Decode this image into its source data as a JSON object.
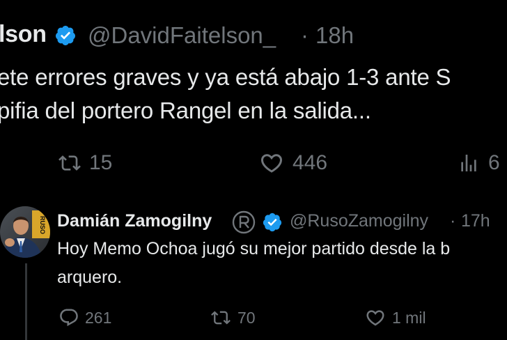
{
  "tweet_top": {
    "name_fragment": "lson",
    "handle": "@DavidFaitelson_",
    "separator": "·",
    "time": "18h",
    "text_line1": "ete errores graves y ya está abajo 1-3 ante S",
    "text_line2": "pifia del portero Rangel en la salida...",
    "retweets": "15",
    "likes": "446",
    "views_fragment": "6"
  },
  "tweet_reply": {
    "name": "Damián Zamogilny",
    "handle": "@RusoZamogilny",
    "separator": "·",
    "time": "17h",
    "text_line1": "Hoy Memo Ochoa jugó su mejor partido desde la b",
    "text_line2": "arquero.",
    "replies": "261",
    "retweets": "70",
    "likes": "1 mil",
    "avatar_logo_text": "RUSO"
  },
  "colors": {
    "background": "#000000",
    "text_primary": "#e7e9ea",
    "text_secondary": "#71767b",
    "verified_blue": "#1d9bf0",
    "thread_line": "#333639"
  },
  "icons": [
    "verified-badge-icon",
    "retweet-icon",
    "heart-icon",
    "views-icon",
    "reply-icon",
    "registered-icon"
  ]
}
